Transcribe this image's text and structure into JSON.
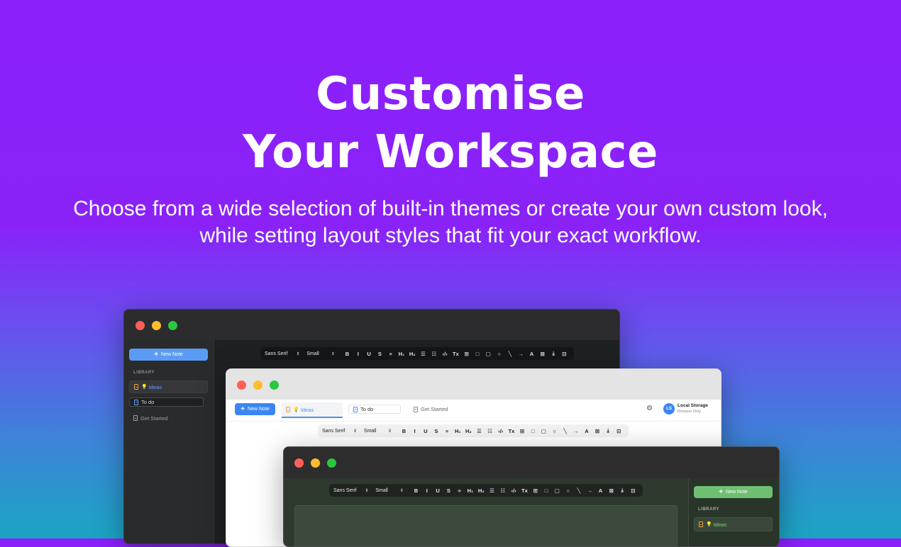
{
  "hero": {
    "title_line1": "Customise",
    "title_line2": "Your Workspace",
    "subtitle_line1": "Choose from a wide selection of built-in themes or create your own custom look,",
    "subtitle_line2": "while setting layout styles that fit your exact workflow."
  },
  "toolbar": {
    "font_family": "Sans Serif",
    "font_size": "Small",
    "tools": [
      "B",
      "I",
      "U",
      "S",
      "≡",
      "H₁",
      "H₂",
      "☰",
      "☷",
      "‹/›",
      "Tx",
      "⊞",
      "□",
      "▢",
      "○",
      "╲",
      "→",
      "A",
      "⊠",
      "⤓",
      "⊡"
    ]
  },
  "dark_window": {
    "new_note_label": "New Note",
    "library_label": "LIBRARY",
    "items": [
      {
        "emoji": "💡",
        "label": "Ideas"
      },
      {
        "label": "To do"
      },
      {
        "label": "Get Started"
      }
    ]
  },
  "light_window": {
    "new_note_label": "New Note",
    "tabs": [
      {
        "emoji": "💡",
        "label": "Ideas"
      },
      {
        "label": "To do"
      },
      {
        "label": "Get Started"
      }
    ],
    "storage_avatar": "LS",
    "storage_title": "Local Storage",
    "storage_sub": "Browser Only"
  },
  "green_window": {
    "new_note_label": "New Note",
    "library_label": "LIBRARY",
    "items": [
      {
        "emoji": "💡",
        "label": "Ideas"
      }
    ]
  },
  "colors": {
    "dark_bg": "#1f2021",
    "dark_sidebar": "#2a2b2d",
    "light_bg": "#ffffff",
    "green_bg": "#2f3a2f",
    "accent_blue": "#4c90f0",
    "accent_green": "#6fbf73"
  }
}
